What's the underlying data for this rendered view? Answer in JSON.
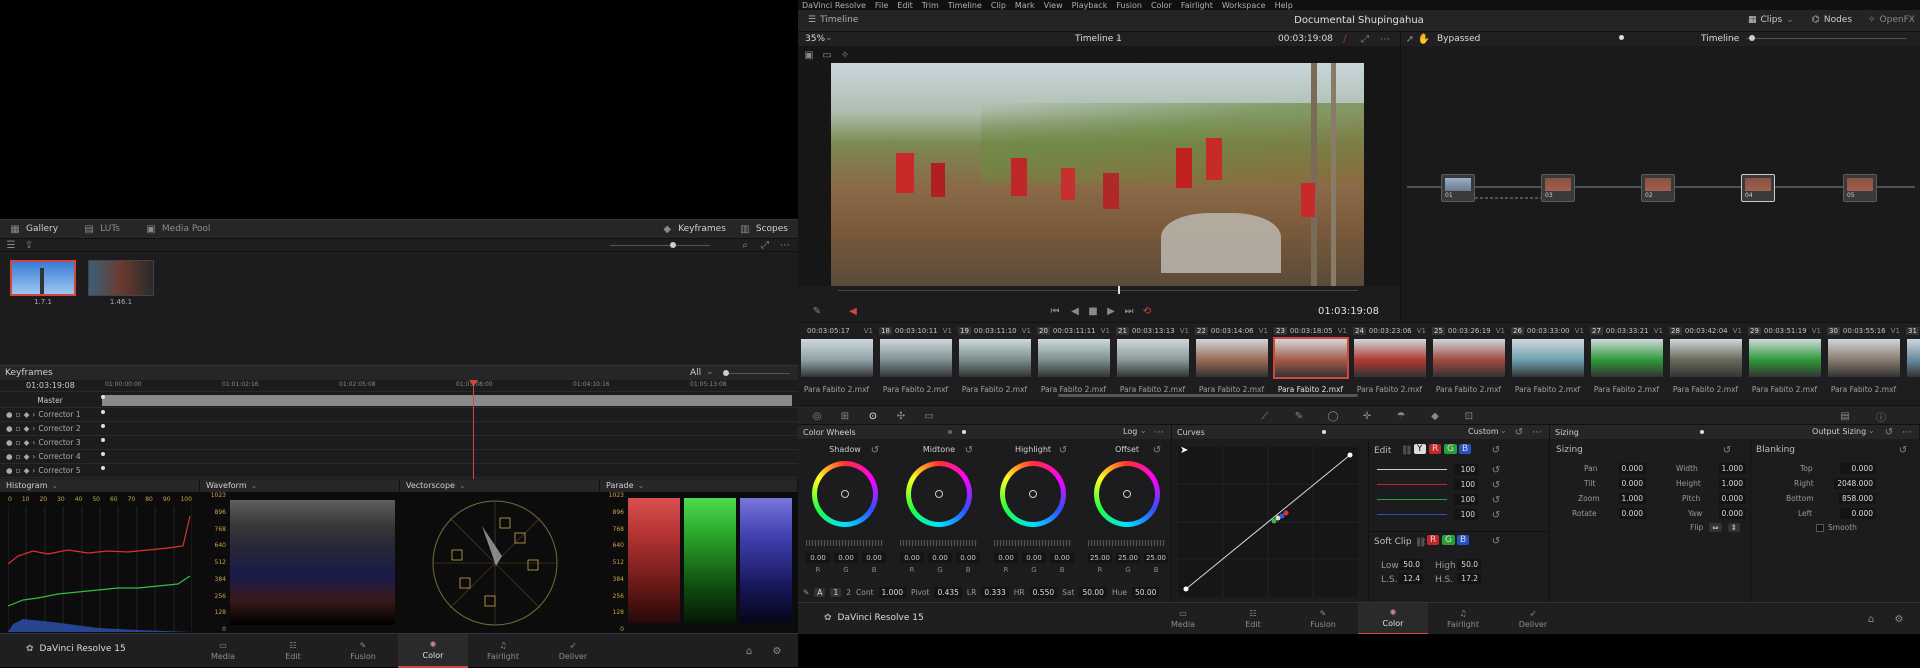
{
  "app": {
    "name": "DaVinci Resolve 15"
  },
  "menu": [
    "DaVinci Resolve",
    "File",
    "Edit",
    "Trim",
    "Timeline",
    "Clip",
    "Mark",
    "View",
    "Playback",
    "Fusion",
    "Color",
    "Fairlight",
    "Workspace",
    "Help"
  ],
  "project_title": "Documental Shupingahua",
  "header": {
    "timeline_label": "Timeline",
    "clips_label": "Clips",
    "nodes_label": "Nodes",
    "openfx_label": "OpenFX"
  },
  "viewer": {
    "zoom": "35%",
    "timeline_name": "Timeline 1",
    "timecode": "00:03:19:08",
    "current_tc": "01:03:19:08"
  },
  "node_editor": {
    "mode": "Bypassed",
    "graph": "Timeline",
    "nodes": [
      {
        "label": "01"
      },
      {
        "label": "03"
      },
      {
        "label": "02"
      },
      {
        "label": "04"
      },
      {
        "label": "05"
      }
    ]
  },
  "gallery": {
    "tabs": [
      "Gallery",
      "LUTs",
      "Media Pool"
    ],
    "right_tabs": [
      "Keyframes",
      "Scopes"
    ],
    "stills": [
      {
        "label": "1.7.1"
      },
      {
        "label": "1.46.1"
      }
    ]
  },
  "keyframes": {
    "title": "Keyframes",
    "filter": "All",
    "timecode": "01:03:19:08",
    "ruler": [
      "01:00:00:00",
      "01:01:02:16",
      "01:02:05:08",
      "01:03:08:00",
      "01:04:10:16",
      "01:05:13:08"
    ],
    "rows": [
      "Master",
      "Corrector 1",
      "Corrector 2",
      "Corrector 3",
      "Corrector 4",
      "Corrector 5"
    ]
  },
  "scopes": {
    "panels": [
      "Histogram",
      "Waveform",
      "Vectorscope",
      "Parade"
    ],
    "histogram_ticks": [
      "0",
      "10",
      "20",
      "30",
      "40",
      "50",
      "60",
      "70",
      "80",
      "90",
      "100"
    ],
    "level_ticks": [
      "1023",
      "896",
      "768",
      "640",
      "512",
      "384",
      "256",
      "128",
      "0"
    ]
  },
  "clips": [
    {
      "num": "",
      "tc": "00:03:05:17",
      "track": "V1",
      "name": "Para Fabito 2.mxf",
      "color": "#8fa3a8"
    },
    {
      "num": "18",
      "tc": "00:03:10:11",
      "track": "V1",
      "name": "Para Fabito 2.mxf",
      "color": "#7e9294"
    },
    {
      "num": "19",
      "tc": "00:03:11:10",
      "track": "V1",
      "name": "Para Fabito 2.mxf",
      "color": "#7a8e8c"
    },
    {
      "num": "20",
      "tc": "00:03:11:11",
      "track": "V1",
      "name": "Para Fabito 2.mxf",
      "color": "#7c908e"
    },
    {
      "num": "21",
      "tc": "00:03:13:13",
      "track": "V1",
      "name": "Para Fabito 2.mxf",
      "color": "#8a9a96"
    },
    {
      "num": "22",
      "tc": "00:03:14:06",
      "track": "V1",
      "name": "Para Fabito 2.mxf",
      "color": "#9a6a54"
    },
    {
      "num": "23",
      "tc": "00:03:18:05",
      "track": "V1",
      "name": "Para Fabito 2.mxf",
      "color": "#a45a48"
    },
    {
      "num": "24",
      "tc": "00:03:23:06",
      "track": "V1",
      "name": "Para Fabito 2.mxf",
      "color": "#b03a32"
    },
    {
      "num": "25",
      "tc": "00:03:26:19",
      "track": "V1",
      "name": "Para Fabito 2.mxf",
      "color": "#a04a40"
    },
    {
      "num": "26",
      "tc": "00:03:33:00",
      "track": "V1",
      "name": "Para Fabito 2.mxf",
      "color": "#6fa0b0"
    },
    {
      "num": "27",
      "tc": "00:03:33:21",
      "track": "V1",
      "name": "Para Fabito 2.mxf",
      "color": "#2e9a3a"
    },
    {
      "num": "28",
      "tc": "00:03:42:04",
      "track": "V1",
      "name": "Para Fabito 2.mxf",
      "color": "#6a6a5a"
    },
    {
      "num": "29",
      "tc": "00:03:51:19",
      "track": "V1",
      "name": "Para Fabito 2.mxf",
      "color": "#2e9a3a"
    },
    {
      "num": "30",
      "tc": "00:03:55:16",
      "track": "V1",
      "name": "Para Fabito 2.mxf",
      "color": "#8a7a70"
    },
    {
      "num": "31",
      "tc": "",
      "track": "",
      "name": "",
      "color": "#6a8aa0"
    }
  ],
  "color_wheels": {
    "title": "Color Wheels",
    "mode": "Log",
    "wheels": [
      {
        "name": "Shadow",
        "vals": [
          "0.00",
          "0.00",
          "0.00"
        ]
      },
      {
        "name": "Midtone",
        "vals": [
          "0.00",
          "0.00",
          "0.00"
        ]
      },
      {
        "name": "Highlight",
        "vals": [
          "0.00",
          "0.00",
          "0.00"
        ]
      },
      {
        "name": "Offset",
        "vals": [
          "25.00",
          "25.00",
          "25.00"
        ]
      }
    ],
    "rgb_labels": [
      "R",
      "G",
      "B"
    ],
    "footer": {
      "page1": "1",
      "page2": "2",
      "cont_label": "Cont",
      "cont": "1.000",
      "pivot_label": "Pivot",
      "pivot": "0.435",
      "lr_label": "LR",
      "lr": "0.333",
      "hr_label": "HR",
      "hr": "0.550",
      "sat_label": "Sat",
      "sat": "50.00",
      "hue_label": "Hue",
      "hue": "50.00"
    }
  },
  "curves": {
    "title": "Curves",
    "mode": "Custom",
    "edit_label": "Edit",
    "channels": [
      "Y",
      "R",
      "G",
      "B"
    ],
    "intensity": [
      "100",
      "100",
      "100",
      "100"
    ],
    "soft_clip": {
      "title": "Soft Clip",
      "low_label": "Low",
      "low": "50.0",
      "high_label": "High",
      "high": "50.0",
      "ls_label": "L.S.",
      "ls": "12.4",
      "hs_label": "H.S.",
      "hs": "17.2"
    }
  },
  "sizing": {
    "title": "Sizing",
    "mode": "Output Sizing",
    "section": "Sizing",
    "left": [
      {
        "label": "Pan",
        "val": "0.000"
      },
      {
        "label": "Tilt",
        "val": "0.000"
      },
      {
        "label": "Zoom",
        "val": "1.000"
      },
      {
        "label": "Rotate",
        "val": "0.000"
      }
    ],
    "right": [
      {
        "label": "Width",
        "val": "1.000"
      },
      {
        "label": "Height",
        "val": "1.000"
      },
      {
        "label": "Pitch",
        "val": "0.000"
      },
      {
        "label": "Yaw",
        "val": "0.000"
      }
    ],
    "flip_label": "Flip",
    "blanking": {
      "title": "Blanking",
      "items": [
        {
          "label": "Top",
          "val": "0.000"
        },
        {
          "label": "Right",
          "val": "2048.000"
        },
        {
          "label": "Bottom",
          "val": "858.000"
        },
        {
          "label": "Left",
          "val": "0.000"
        }
      ],
      "smooth": "Smooth"
    }
  },
  "pages": [
    "Media",
    "Edit",
    "Fusion",
    "Color",
    "Fairlight",
    "Deliver"
  ],
  "active_page": "Color"
}
